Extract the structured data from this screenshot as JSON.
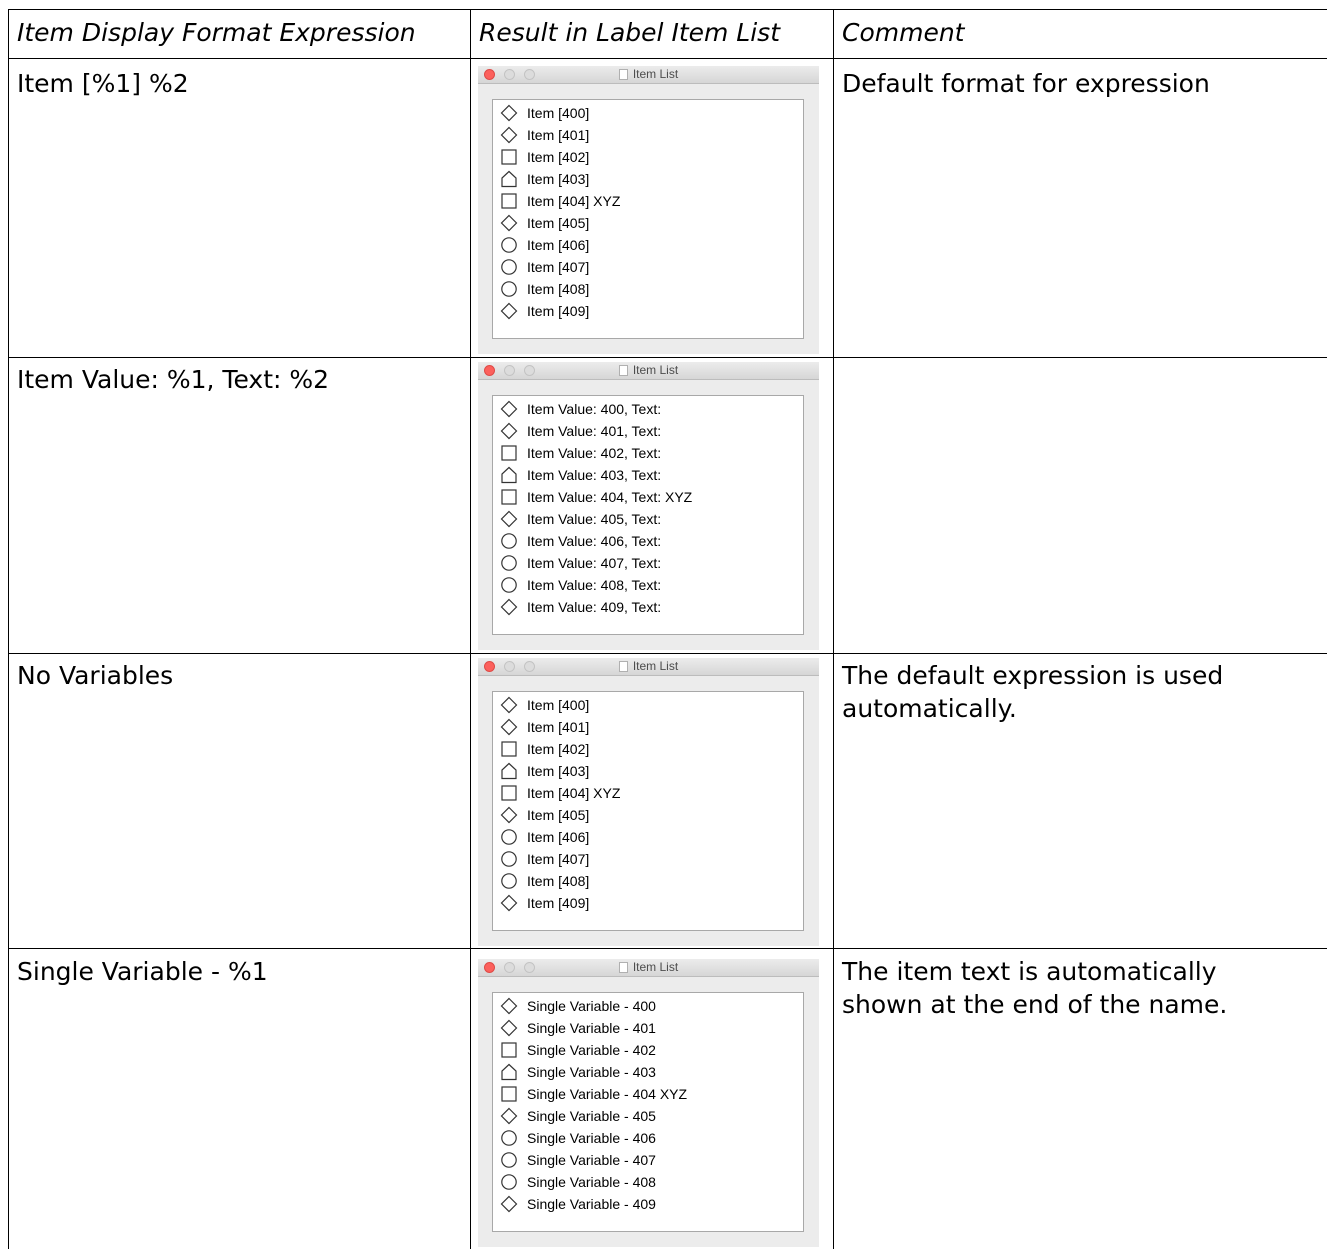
{
  "headers": {
    "col1": "Item Display Format Expression",
    "col2": "Result in Label Item List",
    "col3": "Comment"
  },
  "window_title": "Item List",
  "shapes": [
    "diamond",
    "diamond",
    "square",
    "house",
    "square",
    "diamond",
    "circle",
    "circle",
    "circle",
    "diamond"
  ],
  "rows": [
    {
      "expression": "Item [%1] %2",
      "comment": [
        "Default format for expression"
      ],
      "items": [
        "Item [400]",
        "Item [401]",
        "Item [402]",
        "Item [403]",
        "Item [404] XYZ",
        "Item [405]",
        "Item [406]",
        "Item [407]",
        "Item [408]",
        "Item [409]"
      ]
    },
    {
      "expression": "Item Value: %1, Text: %2",
      "comment": [],
      "items": [
        "Item Value: 400, Text:",
        "Item Value: 401, Text:",
        "Item Value: 402, Text:",
        "Item Value: 403, Text:",
        "Item Value: 404, Text: XYZ",
        "Item Value: 405, Text:",
        "Item Value: 406, Text:",
        "Item Value: 407, Text:",
        "Item Value: 408, Text:",
        "Item Value: 409, Text:"
      ]
    },
    {
      "expression": "No Variables",
      "comment": [
        "The default expression is used",
        "automatically."
      ],
      "items": [
        "Item [400]",
        "Item [401]",
        "Item [402]",
        "Item [403]",
        "Item [404] XYZ",
        "Item [405]",
        "Item [406]",
        "Item [407]",
        "Item [408]",
        "Item [409]"
      ]
    },
    {
      "expression": "Single Variable - %1",
      "comment": [
        "The item text is automatically",
        "shown at the end of the name."
      ],
      "items": [
        "Single Variable - 400",
        "Single Variable - 401",
        "Single Variable - 402",
        "Single Variable - 403",
        "Single Variable - 404 XYZ",
        "Single Variable - 405",
        "Single Variable - 406",
        "Single Variable - 407",
        "Single Variable - 408",
        "Single Variable - 409"
      ]
    }
  ]
}
